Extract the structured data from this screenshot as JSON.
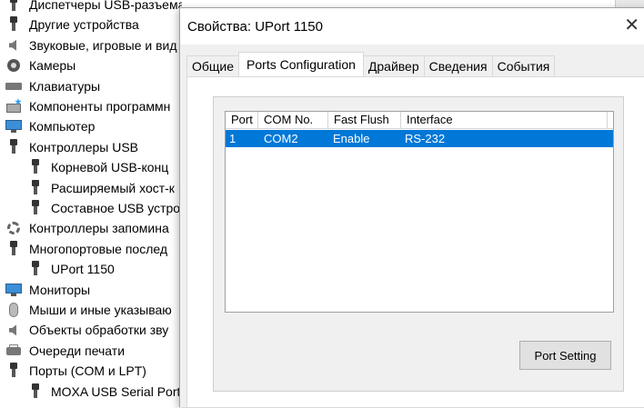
{
  "device_tree": {
    "items": [
      {
        "label": "Диспетчеры USB-разъема",
        "icon": "usb-icon",
        "indent": 0
      },
      {
        "label": "Другие устройства",
        "icon": "unknown-device-icon",
        "indent": 0
      },
      {
        "label": "Звуковые, игровые и вид",
        "icon": "speaker-icon",
        "indent": 0
      },
      {
        "label": "Камеры",
        "icon": "camera-icon",
        "indent": 0
      },
      {
        "label": "Клавиатуры",
        "icon": "keyboard-icon",
        "indent": 0
      },
      {
        "label": "Компоненты программн",
        "icon": "software-component-icon",
        "indent": 0
      },
      {
        "label": "Компьютер",
        "icon": "monitor-icon",
        "indent": 0
      },
      {
        "label": "Контроллеры USB",
        "icon": "usb-icon",
        "indent": 0
      },
      {
        "label": "Корневой USB-конц",
        "icon": "usb-icon",
        "indent": 1
      },
      {
        "label": "Расширяемый хост-к",
        "icon": "usb-icon",
        "indent": 1
      },
      {
        "label": "Составное USB устро",
        "icon": "usb-icon",
        "indent": 1
      },
      {
        "label": "Контроллеры запомина",
        "icon": "storage-controller-icon",
        "indent": 0
      },
      {
        "label": "Многопортовые послед",
        "icon": "usb-icon",
        "indent": 0
      },
      {
        "label": "UPort 1150",
        "icon": "usb-icon",
        "indent": 1
      },
      {
        "label": "Мониторы",
        "icon": "monitor-icon",
        "indent": 0
      },
      {
        "label": "Мыши и иные указываю",
        "icon": "mouse-icon",
        "indent": 0
      },
      {
        "label": "Объекты обработки зву",
        "icon": "speaker-icon",
        "indent": 0
      },
      {
        "label": "Очереди печати",
        "icon": "printer-icon",
        "indent": 0
      },
      {
        "label": "Порты (COM и LPT)",
        "icon": "usb-icon",
        "indent": 0
      },
      {
        "label": "MOXA USB Serial Port",
        "icon": "usb-icon",
        "indent": 1
      }
    ]
  },
  "dialog": {
    "title": "Свойства: UPort 1150",
    "close_glyph": "✕",
    "tabs": [
      {
        "label": "Общие",
        "active": false
      },
      {
        "label": "Ports Configuration",
        "active": true
      },
      {
        "label": "Драйвер",
        "active": false
      },
      {
        "label": "Сведения",
        "active": false
      },
      {
        "label": "События",
        "active": false
      }
    ],
    "ports_table": {
      "columns": [
        "Port",
        "COM No.",
        "Fast Flush",
        "Interface"
      ],
      "rows": [
        {
          "port": "1",
          "com": "COM2",
          "fast_flush": "Enable",
          "interface": "RS-232",
          "selected": true
        }
      ]
    },
    "port_setting_label": "Port Setting"
  },
  "colors": {
    "selection": "#0078d7",
    "dialog_bg": "#f0f0f0"
  }
}
